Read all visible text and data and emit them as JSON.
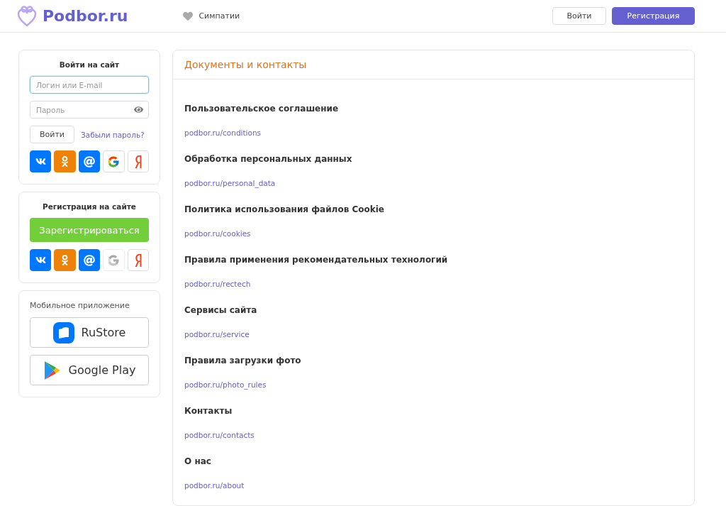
{
  "header": {
    "logo": "Podbor.ru",
    "nav": [
      {
        "label": "Симпатии"
      }
    ],
    "buttons": [
      {
        "label": "Войти",
        "kind": "outline"
      },
      {
        "label": "Регистрация",
        "kind": "primary"
      }
    ]
  },
  "login": {
    "title": "Войти на сайт",
    "login_field": {
      "placeholder": "Логин или E-mail",
      "focused": true
    },
    "password_field": {
      "placeholder": "Пароль"
    },
    "submit": "Войти",
    "forgot": "Забыли пароль?",
    "social": [
      {
        "kind": "vk",
        "disabled": false
      },
      {
        "kind": "ok",
        "disabled": false
      },
      {
        "kind": "mail",
        "disabled": false
      },
      {
        "kind": "google",
        "disabled": false
      },
      {
        "kind": "yandex",
        "disabled": false
      }
    ]
  },
  "register": {
    "title": "Регистрация на сайте",
    "button": "Зарегистрироваться",
    "social": [
      {
        "kind": "vk",
        "disabled": false
      },
      {
        "kind": "ok",
        "disabled": false
      },
      {
        "kind": "mail",
        "disabled": false
      },
      {
        "kind": "google",
        "disabled": true
      },
      {
        "kind": "yandex",
        "disabled": false
      }
    ]
  },
  "mobile": {
    "title": "Мобильное приложение",
    "stores": [
      {
        "kind": "rustore",
        "label": "RuStore"
      },
      {
        "kind": "googleplay",
        "label": "Google Play"
      }
    ]
  },
  "documents": {
    "title": "Документы и контакты",
    "items": [
      {
        "title": "Пользовательское соглашение",
        "link": "podbor.ru/conditions"
      },
      {
        "title": "Обработка персональных данных",
        "link": "podbor.ru/personal_data"
      },
      {
        "title": "Политика использования файлов Cookie",
        "link": "podbor.ru/cookies"
      },
      {
        "title": "Правила применения рекомендательных технологий",
        "link": "podbor.ru/rectech"
      },
      {
        "title": "Сервисы сайта",
        "link": "podbor.ru/service"
      },
      {
        "title": "Правила загрузки фото",
        "link": "podbor.ru/photo_rules"
      },
      {
        "title": "Контакты",
        "link": "podbor.ru/contacts"
      },
      {
        "title": "О нас",
        "link": "podbor.ru/about"
      }
    ]
  }
}
